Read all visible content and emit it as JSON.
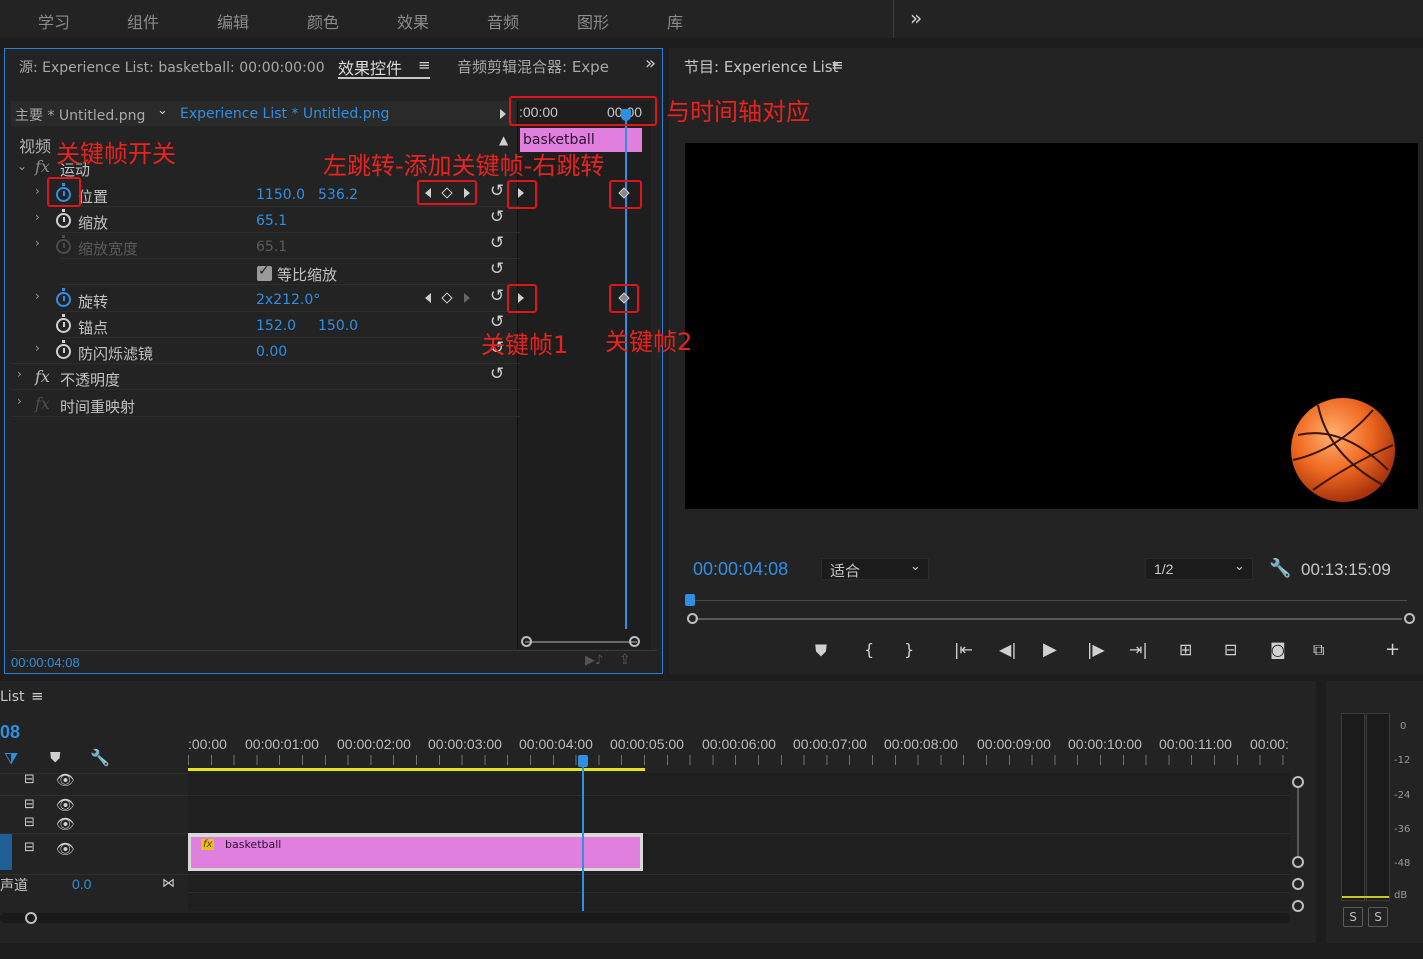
{
  "workspace_tabs": [
    "学习",
    "组件",
    "编辑",
    "颜色",
    "效果",
    "音频",
    "图形",
    "库"
  ],
  "topbar_more": "»",
  "left_panel": {
    "tab_source": "源: Experience List: basketball: 00:00:00:00",
    "tab_effects": "效果控件",
    "tab_audio_mixer": "音频剪辑混合器: Expe",
    "panel_more": "»",
    "master_clip": "主要 * Untitled.png",
    "sequence_clip": "Experience List * Untitled.png",
    "ruler_start": ":00:00",
    "ruler_end": "00:00",
    "clip_bar_label": "basketball",
    "section_video": "视频",
    "motion": "运动",
    "props": [
      {
        "label": "位置",
        "v1": "1150.0",
        "v2": "536.2"
      },
      {
        "label": "缩放",
        "v1": "65.1",
        "v2": ""
      },
      {
        "label": "缩放宽度",
        "v1": "65.1",
        "v2": ""
      },
      {
        "label": "等比缩放",
        "v1": "",
        "v2": ""
      },
      {
        "label": "旋转",
        "v1": "2x212.0°",
        "v2": ""
      },
      {
        "label": "锚点",
        "v1": "152.0",
        "v2": "150.0"
      },
      {
        "label": "防闪烁滤镜",
        "v1": "0.00",
        "v2": ""
      }
    ],
    "opacity": "不透明度",
    "time_remap": "时间重映射",
    "current_time": "00:00:04:08"
  },
  "annotations": {
    "timeline_align": "与时间轴对应",
    "keyframe_toggle": "关键帧开关",
    "nav_buttons": "左跳转-添加关键帧-右跳转",
    "keyframe1": "关键帧1",
    "keyframe2": "关键帧2"
  },
  "program": {
    "title": "节目: Experience List",
    "timecode": "00:00:04:08",
    "fit": "适合",
    "resolution": "1/2",
    "duration": "00:13:15:09"
  },
  "timeline": {
    "title": "List",
    "timecode": "08",
    "ruler": [
      ":00:00",
      "00:00:01:00",
      "00:00:02:00",
      "00:00:03:00",
      "00:00:04:00",
      "00:00:05:00",
      "00:00:06:00",
      "00:00:07:00",
      "00:00:08:00",
      "00:00:09:00",
      "00:00:10:00",
      "00:00:11:00",
      "00:00:"
    ],
    "clip_label": "basketball",
    "audio_track_label": "声道",
    "audio_value": "0.0"
  },
  "meter": {
    "scale": [
      "0",
      "-12",
      "-24",
      "-36",
      "-48",
      "dB"
    ],
    "solo": "S"
  },
  "colors": {
    "accent": "#2f8fe3",
    "clip": "#e07fde",
    "annotation": "#e0141b",
    "work_area": "#e3e31f"
  }
}
